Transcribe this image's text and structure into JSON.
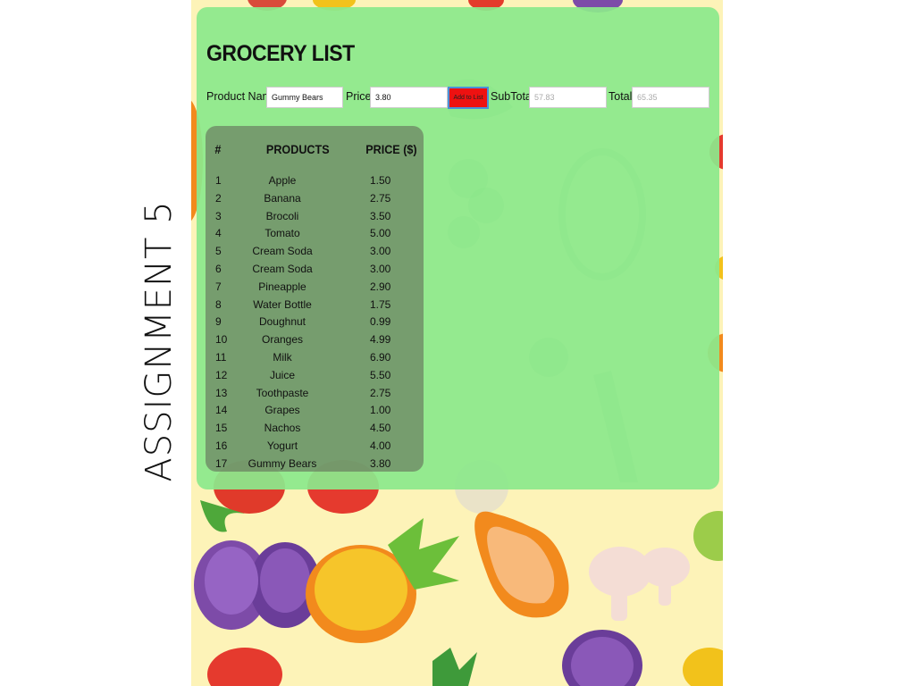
{
  "slide": {
    "caption": "ASSIGNMENT 5"
  },
  "app": {
    "title": "GROCERY LIST",
    "form": {
      "product_label": "Product Name:",
      "product_value": "Gummy Bears",
      "price_label": "Price:",
      "price_value": "3.80",
      "add_button": "Add to List",
      "subtotal_label": "SubTotal:",
      "subtotal_value": "57.83",
      "total_label": "Total:",
      "total_value": "65.35"
    },
    "table": {
      "headers": [
        "#",
        "PRODUCTS",
        "PRICE ($)"
      ],
      "rows": [
        {
          "num": "1",
          "name": "Apple",
          "price": "1.50"
        },
        {
          "num": "2",
          "name": "Banana",
          "price": "2.75"
        },
        {
          "num": "3",
          "name": "Brocoli",
          "price": "3.50"
        },
        {
          "num": "4",
          "name": "Tomato",
          "price": "5.00"
        },
        {
          "num": "5",
          "name": "Cream Soda",
          "price": "3.00"
        },
        {
          "num": "6",
          "name": "Cream Soda",
          "price": "3.00"
        },
        {
          "num": "7",
          "name": "Pineapple",
          "price": "2.90"
        },
        {
          "num": "8",
          "name": "Water Bottle",
          "price": "1.75"
        },
        {
          "num": "9",
          "name": "Doughnut",
          "price": "0.99"
        },
        {
          "num": "10",
          "name": "Oranges",
          "price": "4.99"
        },
        {
          "num": "11",
          "name": "Milk",
          "price": "6.90"
        },
        {
          "num": "12",
          "name": "Juice",
          "price": "5.50"
        },
        {
          "num": "13",
          "name": "Toothpaste",
          "price": "2.75"
        },
        {
          "num": "14",
          "name": "Grapes",
          "price": "1.00"
        },
        {
          "num": "15",
          "name": "Nachos",
          "price": "4.50"
        },
        {
          "num": "16",
          "name": "Yogurt",
          "price": "4.00"
        },
        {
          "num": "17",
          "name": "Gummy Bears",
          "price": "3.80"
        }
      ]
    }
  },
  "colors": {
    "panel": "#8ce88c",
    "background": "#fdf3b8",
    "button": "#ee1111",
    "table_card": "#6e7a5c"
  }
}
